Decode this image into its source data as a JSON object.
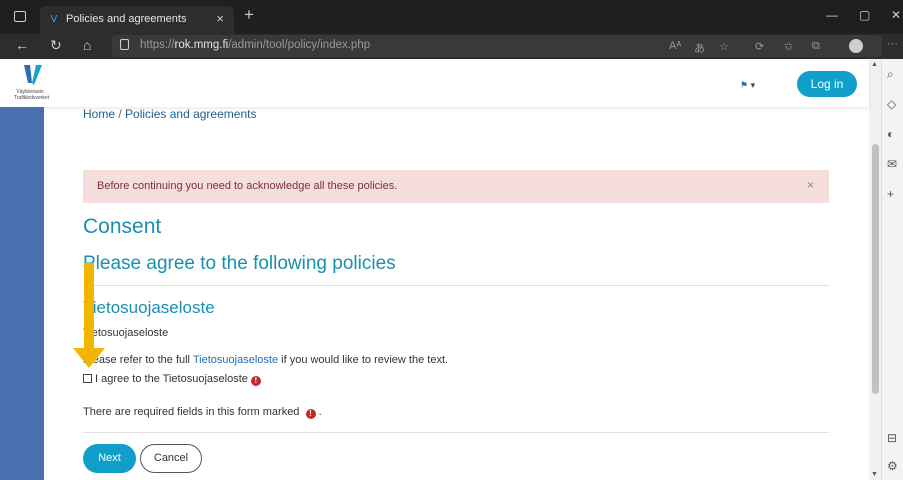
{
  "browser": {
    "tab_title": "Policies and agreements",
    "tab_close": "×",
    "new_tab": "+",
    "url_prefix": "https://",
    "url_domain": "rok.mmg.fi",
    "url_path": "/admin/tool/policy/index.php"
  },
  "header": {
    "logo_text_line1": "Väylävirasto",
    "logo_text_line2": "Trafikledsverket",
    "lang_caret": "▾",
    "login_label": "Log in"
  },
  "breadcrumb": {
    "home": "Home",
    "separator": "/",
    "current": "Policies and agreements"
  },
  "alert": {
    "message": "Before continuing you need to acknowledge all these policies.",
    "close": "×"
  },
  "content": {
    "heading": "Consent",
    "subheading": "Please agree to the following policies",
    "policy_title": "Tietosuojaseloste",
    "policy_summary": "Tietosuojaseloste",
    "refer_before": "Please refer to the full",
    "refer_link": "Tietosuojaseloste",
    "refer_after": "if you would like to review the text.",
    "agree_label": "I agree to the Tietosuojaseloste",
    "required_note": "There are required fields in this form marked",
    "required_note_end": ".",
    "required_mark": "!"
  },
  "buttons": {
    "next": "Next",
    "cancel": "Cancel"
  },
  "colors": {
    "accent": "#0f9fc9",
    "heading": "#1a8fb0",
    "alert_bg": "#f6dedd",
    "left_bar": "#4a6fb0",
    "annotation_arrow": "#f2b600"
  }
}
